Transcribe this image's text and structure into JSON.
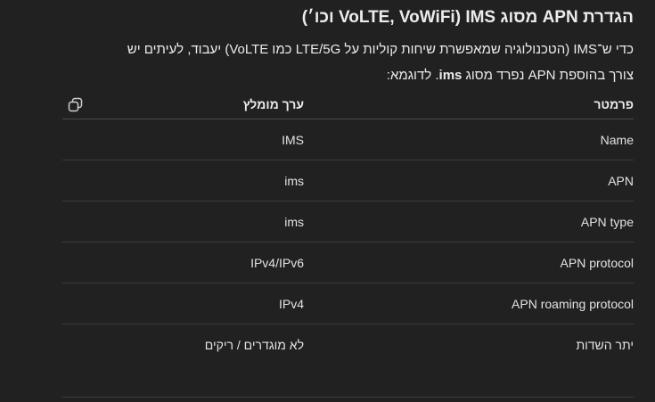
{
  "heading": "הגדרת APN מסוג IMS (VoLTE, VoWiFi וכו׳)",
  "intro": {
    "line1": "כדי ש־IMS (הטכנולוגיה שמאפשרת שיחות קוליות על LTE/5G כמו VoLTE) יעבוד, לעיתים יש",
    "line2_prefix": "צורך בהוספת APN נפרד מסוג ",
    "line2_bold": "ims",
    "line2_suffix": ". לדוגמא:"
  },
  "table": {
    "headers": {
      "parameter": "פרמטר",
      "value": "ערך מומלץ"
    },
    "rows": [
      {
        "parameter": "Name",
        "value": "IMS"
      },
      {
        "parameter": "APN",
        "value": "ims"
      },
      {
        "parameter": "APN type",
        "value": "ims"
      },
      {
        "parameter": "APN protocol",
        "value": "IPv4/IPv6"
      },
      {
        "parameter": "APN roaming protocol",
        "value": "IPv4"
      },
      {
        "parameter": "יתר השדות",
        "value": "לא מוגדרים / ריקים"
      }
    ]
  },
  "icons": {
    "copy": "copy-icon"
  }
}
